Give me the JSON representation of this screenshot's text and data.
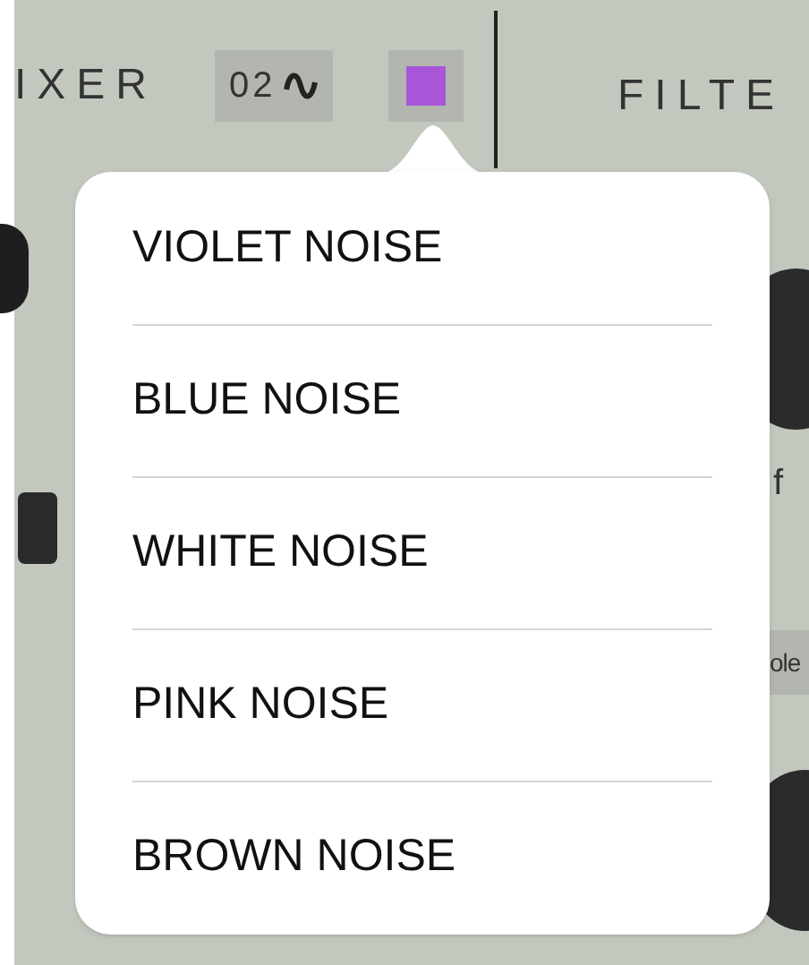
{
  "header": {
    "section_left": "IXER",
    "oscillator_button": "02",
    "section_right": "FILTE"
  },
  "background_labels": {
    "cutoff_fragment": "f",
    "mode_fragment": "ole"
  },
  "noise_menu": {
    "items": [
      {
        "label": "VIOLET NOISE"
      },
      {
        "label": "BLUE NOISE"
      },
      {
        "label": "WHITE NOISE"
      },
      {
        "label": "PINK NOISE"
      },
      {
        "label": "BROWN NOISE"
      }
    ]
  }
}
